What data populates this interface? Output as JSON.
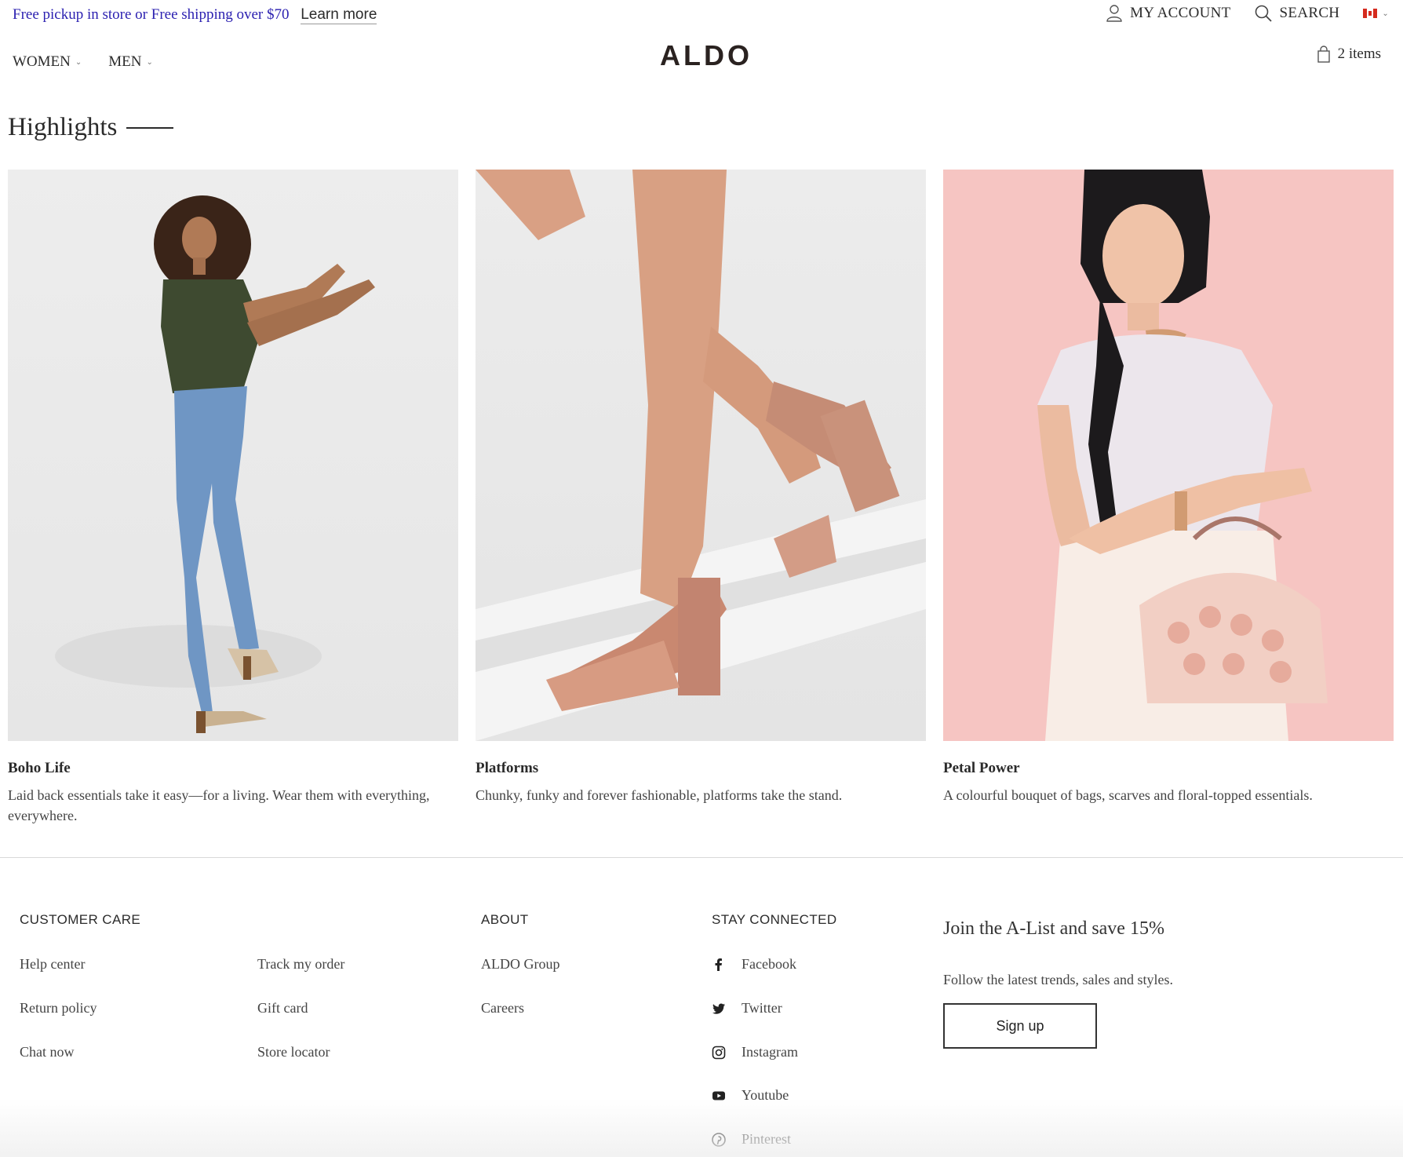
{
  "promo": {
    "text": "Free pickup in store or Free shipping over $70",
    "link": "Learn more"
  },
  "header": {
    "logo": "ALDO",
    "account_label": "MY ACCOUNT",
    "search_label": "SEARCH",
    "cart_label": "2 items",
    "nav": [
      {
        "label": "WOMEN"
      },
      {
        "label": "MEN"
      }
    ]
  },
  "highlights": {
    "title": "Highlights",
    "cards": [
      {
        "title": "Boho Life",
        "desc": "Laid back essentials take it easy—for a living. Wear them with everything, everywhere."
      },
      {
        "title": "Platforms",
        "desc": "Chunky, funky and forever fashionable, platforms take the stand."
      },
      {
        "title": "Petal Power",
        "desc": "A colourful bouquet of bags, scarves and floral-topped essentials."
      }
    ]
  },
  "footer": {
    "customer_care": {
      "heading": "CUSTOMER CARE",
      "col1": [
        "Help center",
        "Return policy",
        "Chat now"
      ],
      "col2": [
        "Track my order",
        "Gift card",
        "Store locator"
      ]
    },
    "about": {
      "heading": "ABOUT",
      "links": [
        "ALDO Group",
        "Careers"
      ]
    },
    "stay_connected": {
      "heading": "STAY CONNECTED",
      "links": [
        {
          "label": "Facebook",
          "icon": "facebook-icon"
        },
        {
          "label": "Twitter",
          "icon": "twitter-icon"
        },
        {
          "label": "Instagram",
          "icon": "instagram-icon"
        },
        {
          "label": "Youtube",
          "icon": "youtube-icon"
        },
        {
          "label": "Pinterest",
          "icon": "pinterest-icon"
        }
      ]
    },
    "join": {
      "title": "Join the A-List and save 15%",
      "subtitle": "Follow the latest trends, sales and styles.",
      "button": "Sign up"
    }
  },
  "colors": {
    "promo_text": "#2a1fb0",
    "text": "#2b2b2b",
    "petal_bg": "#f6c5c2",
    "photo_bg": "#ececec"
  }
}
